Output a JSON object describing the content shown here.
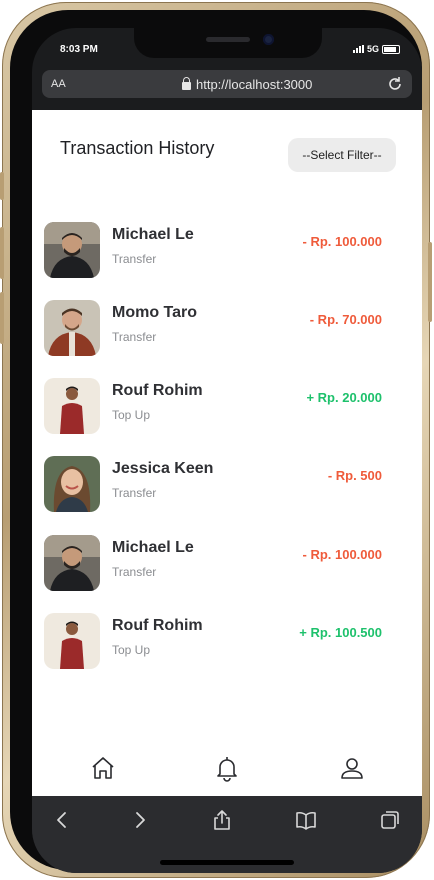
{
  "status_bar": {
    "time": "8:03 PM",
    "network": "5G"
  },
  "browser": {
    "text_size_label": "AA",
    "url": "http://localhost:3000"
  },
  "page": {
    "title": "Transaction History",
    "filter_label": "--Select Filter--"
  },
  "transactions": [
    {
      "name": "Michael Le",
      "type": "Transfer",
      "amount": "- Rp. 100.000",
      "direction": "out",
      "avatar": "man-dark-jacket"
    },
    {
      "name": "Momo Taro",
      "type": "Transfer",
      "amount": "- Rp. 70.000",
      "direction": "out",
      "avatar": "man-red-jacket"
    },
    {
      "name": "Rouf Rohim",
      "type": "Top Up",
      "amount": "+ Rp. 20.000",
      "direction": "in",
      "avatar": "man-red-shirt"
    },
    {
      "name": "Jessica Keen",
      "type": "Transfer",
      "amount": "- Rp. 500",
      "direction": "out",
      "avatar": "woman-smiling"
    },
    {
      "name": "Michael Le",
      "type": "Transfer",
      "amount": "- Rp. 100.000",
      "direction": "out",
      "avatar": "man-dark-jacket"
    },
    {
      "name": "Rouf Rohim",
      "type": "Top Up",
      "amount": "+ Rp. 100.500",
      "direction": "in",
      "avatar": "man-red-shirt"
    }
  ],
  "bottom_nav": [
    "home-icon",
    "bell-icon",
    "user-icon"
  ],
  "browser_toolbar": [
    "back-icon",
    "forward-icon",
    "share-icon",
    "bookmarks-icon",
    "tabs-icon"
  ],
  "colors": {
    "outgoing": "#ef5b3b",
    "incoming": "#1ec16c"
  }
}
